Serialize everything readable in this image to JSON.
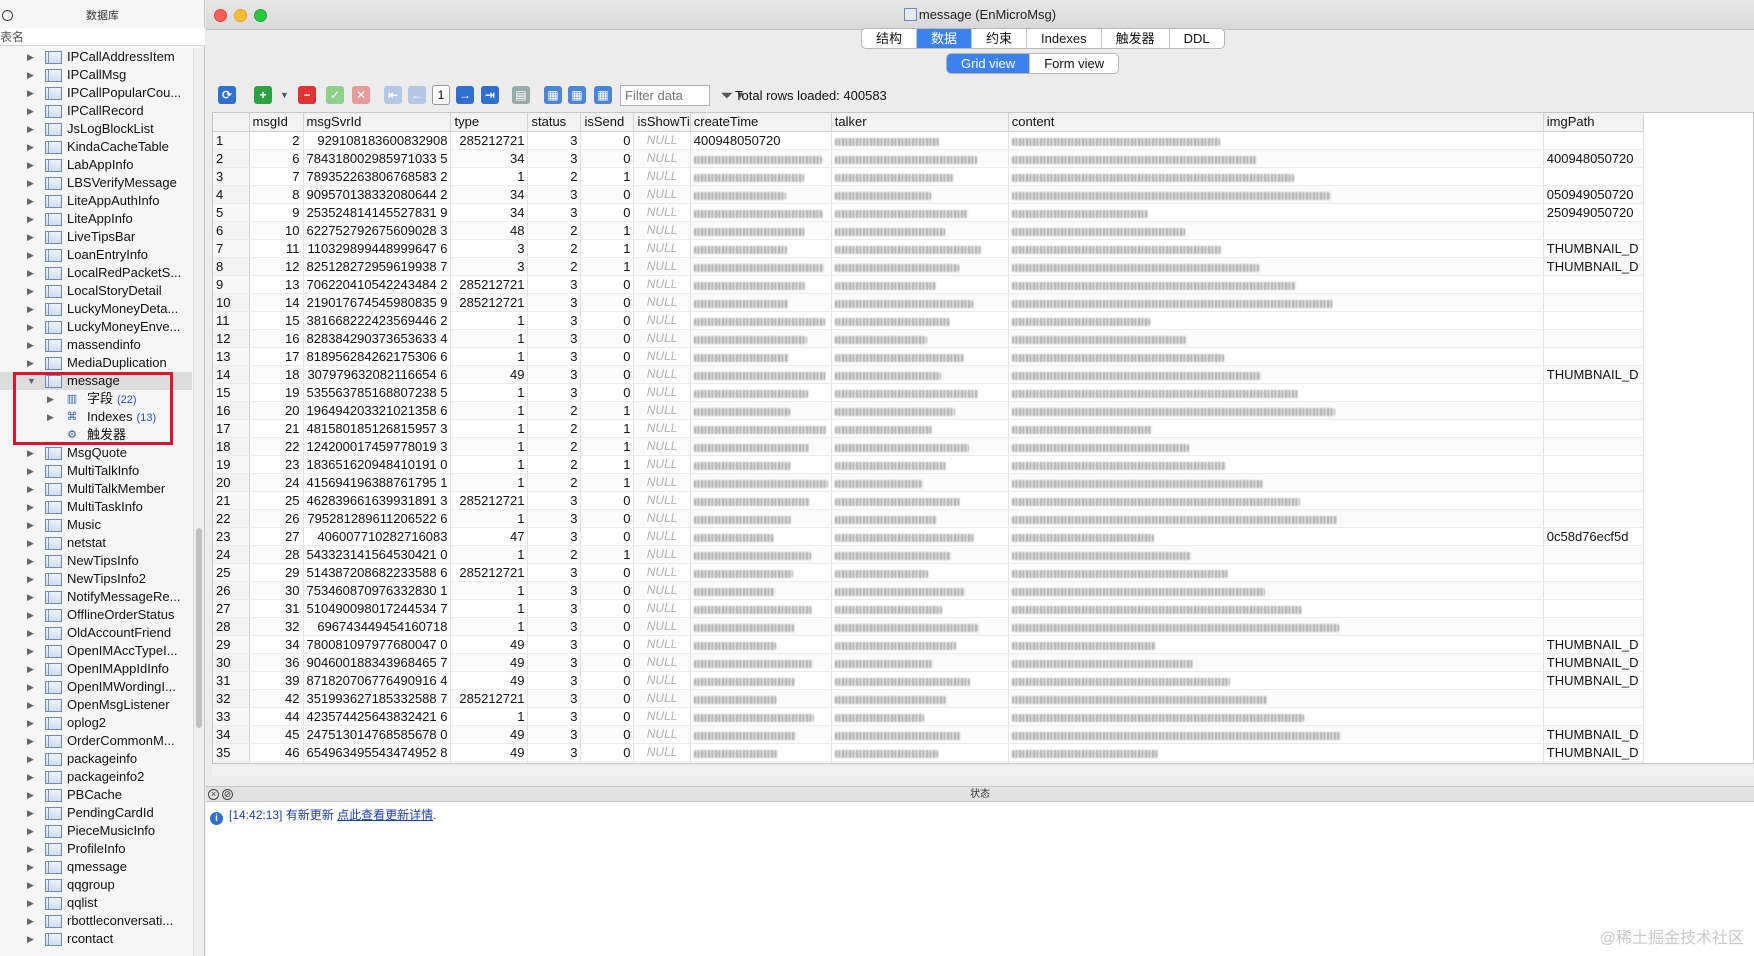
{
  "sidebar": {
    "header": "数据库",
    "search_label": "表名",
    "tables": [
      "IPCallAddressItem",
      "IPCallMsg",
      "IPCallPopularCou...",
      "IPCallRecord",
      "JsLogBlockList",
      "KindaCacheTable",
      "LabAppInfo",
      "LBSVerifyMessage",
      "LiteAppAuthInfo",
      "LiteAppInfo",
      "LiveTipsBar",
      "LoanEntryInfo",
      "LocalRedPacketS...",
      "LocalStoryDetail",
      "LuckyMoneyDeta...",
      "LuckyMoneyEnve...",
      "massendinfo",
      "MediaDuplication"
    ],
    "selected_table": "message",
    "children": [
      {
        "label": "字段",
        "count": "(22)"
      },
      {
        "label": "Indexes",
        "count": "(13)"
      },
      {
        "label": "触发器",
        "count": ""
      }
    ],
    "tables_after": [
      "MsgQuote",
      "MultiTalkInfo",
      "MultiTalkMember",
      "MultiTaskInfo",
      "Music",
      "netstat",
      "NewTipsInfo",
      "NewTipsInfo2",
      "NotifyMessageRe...",
      "OfflineOrderStatus",
      "OldAccountFriend",
      "OpenIMAccTypeI...",
      "OpenIMAppIdInfo",
      "OpenIMWordingI...",
      "OpenMsgListener",
      "oplog2",
      "OrderCommonM...",
      "packageinfo",
      "packageinfo2",
      "PBCache",
      "PendingCardId",
      "PieceMusicInfo",
      "ProfileInfo",
      "qmessage",
      "qqgroup",
      "qqlist",
      "rbottleconversati...",
      "rcontact"
    ]
  },
  "window": {
    "title": "message (EnMicroMsg)"
  },
  "tabs_top": [
    "结构",
    "数据",
    "约束",
    "Indexes",
    "触发器",
    "DDL"
  ],
  "tabs_top_active": "数据",
  "view_tabs": [
    "Grid view",
    "Form view"
  ],
  "view_tabs_active": "Grid view",
  "toolbar": {
    "page_number": "1",
    "filter_placeholder": "Filter data",
    "rows_loaded": "Total rows loaded: 400583"
  },
  "grid": {
    "columns": [
      "msgId",
      "msgSvrId",
      "type",
      "status",
      "isSend",
      "isShowTi",
      "createTime",
      "talker",
      "content",
      "imgPath"
    ],
    "null_text": "NULL",
    "rows": [
      [
        "2",
        "929108183600832908",
        "285212721",
        "3",
        "0",
        "",
        "400948050720",
        "",
        "",
        ""
      ],
      [
        "6",
        "784318002985971033 5",
        "34",
        "3",
        "0",
        "",
        "",
        "",
        "",
        "400948050720"
      ],
      [
        "7",
        "789352263806768583 2",
        "1",
        "2",
        "1",
        "",
        "",
        "",
        "",
        ""
      ],
      [
        "8",
        "909570138332080644 2",
        "34",
        "3",
        "0",
        "",
        "",
        "",
        "",
        "050949050720"
      ],
      [
        "9",
        "253524814145527831 9",
        "34",
        "3",
        "0",
        "",
        "",
        "",
        "",
        "250949050720"
      ],
      [
        "10",
        "622752792675609028 3",
        "48",
        "2",
        "1",
        "",
        "",
        "",
        "",
        ""
      ],
      [
        "11",
        "110329899448999647 6",
        "3",
        "2",
        "1",
        "",
        "",
        "",
        "",
        "THUMBNAIL_D"
      ],
      [
        "12",
        "825128272959619938 7",
        "3",
        "2",
        "1",
        "",
        "",
        "",
        "",
        "THUMBNAIL_D"
      ],
      [
        "13",
        "706220410542243484 2",
        "285212721",
        "3",
        "0",
        "",
        "",
        "",
        "",
        ""
      ],
      [
        "14",
        "219017674545980835 9",
        "285212721",
        "3",
        "0",
        "",
        "",
        "",
        "",
        ""
      ],
      [
        "15",
        "381668222423569446 2",
        "1",
        "3",
        "0",
        "",
        "",
        "",
        "",
        ""
      ],
      [
        "16",
        "828384290373653633 4",
        "1",
        "3",
        "0",
        "",
        "",
        "",
        "",
        ""
      ],
      [
        "17",
        "818956284262175306 6",
        "1",
        "3",
        "0",
        "",
        "",
        "",
        "",
        ""
      ],
      [
        "18",
        "307979632082116654 6",
        "49",
        "3",
        "0",
        "",
        "",
        "",
        "",
        "THUMBNAIL_D"
      ],
      [
        "19",
        "535563785168807238 5",
        "1",
        "3",
        "0",
        "",
        "",
        "",
        "",
        ""
      ],
      [
        "20",
        "196494203321021358 6",
        "1",
        "2",
        "1",
        "",
        "",
        "",
        "",
        ""
      ],
      [
        "21",
        "481580185126815957 3",
        "1",
        "2",
        "1",
        "",
        "",
        "",
        "",
        ""
      ],
      [
        "22",
        "124200017459778019 3",
        "1",
        "2",
        "1",
        "",
        "",
        "",
        "",
        ""
      ],
      [
        "23",
        "183651620948410191 0",
        "1",
        "2",
        "1",
        "",
        "",
        "",
        "",
        ""
      ],
      [
        "24",
        "415694196388761795 1",
        "1",
        "2",
        "1",
        "",
        "",
        "",
        "",
        ""
      ],
      [
        "25",
        "462839661639931891 3",
        "285212721",
        "3",
        "0",
        "",
        "",
        "",
        "",
        ""
      ],
      [
        "26",
        "795281289611206522 6",
        "1",
        "3",
        "0",
        "",
        "",
        "",
        "",
        ""
      ],
      [
        "27",
        "406007710282716083",
        "47",
        "3",
        "0",
        "",
        "",
        "",
        "",
        "0c58d76ecf5d"
      ],
      [
        "28",
        "543323141564530421 0",
        "1",
        "2",
        "1",
        "",
        "",
        "",
        "",
        ""
      ],
      [
        "29",
        "514387208682233588 6",
        "285212721",
        "3",
        "0",
        "",
        "",
        "",
        "",
        ""
      ],
      [
        "30",
        "753460870976332830 1",
        "1",
        "3",
        "0",
        "",
        "",
        "",
        "",
        ""
      ],
      [
        "31",
        "510490098017244534 7",
        "1",
        "3",
        "0",
        "",
        "",
        "",
        "",
        ""
      ],
      [
        "32",
        "696743449454160718",
        "1",
        "3",
        "0",
        "",
        "",
        "",
        "",
        ""
      ],
      [
        "34",
        "780081097977680047 0",
        "49",
        "3",
        "0",
        "",
        "",
        "",
        "",
        "THUMBNAIL_D"
      ],
      [
        "36",
        "904600188343968465 7",
        "49",
        "3",
        "0",
        "",
        "",
        "",
        "",
        "THUMBNAIL_D"
      ],
      [
        "39",
        "871820706776490916 4",
        "49",
        "3",
        "0",
        "",
        "",
        "",
        "",
        "THUMBNAIL_D"
      ],
      [
        "42",
        "351993627185332588 7",
        "285212721",
        "3",
        "0",
        "",
        "",
        "",
        "",
        ""
      ],
      [
        "44",
        "423574425643832421 6",
        "1",
        "3",
        "0",
        "",
        "",
        "",
        "",
        ""
      ],
      [
        "45",
        "247513014768585678 0",
        "49",
        "3",
        "0",
        "",
        "",
        "",
        "",
        "THUMBNAIL_D"
      ],
      [
        "46",
        "654963495543474952 8",
        "49",
        "3",
        "0",
        "",
        "",
        "",
        "",
        "THUMBNAIL_D"
      ],
      [
        "47",
        "145146077509705326 9",
        "1",
        "3",
        "0",
        "",
        "",
        "",
        "",
        ""
      ]
    ]
  },
  "status": {
    "title": "状态",
    "log_time": "[14:42:13]",
    "log_text": "有新更新",
    "log_link": "点此查看更新详情",
    "log_end": "."
  },
  "watermark": "@稀土掘金技术社区"
}
